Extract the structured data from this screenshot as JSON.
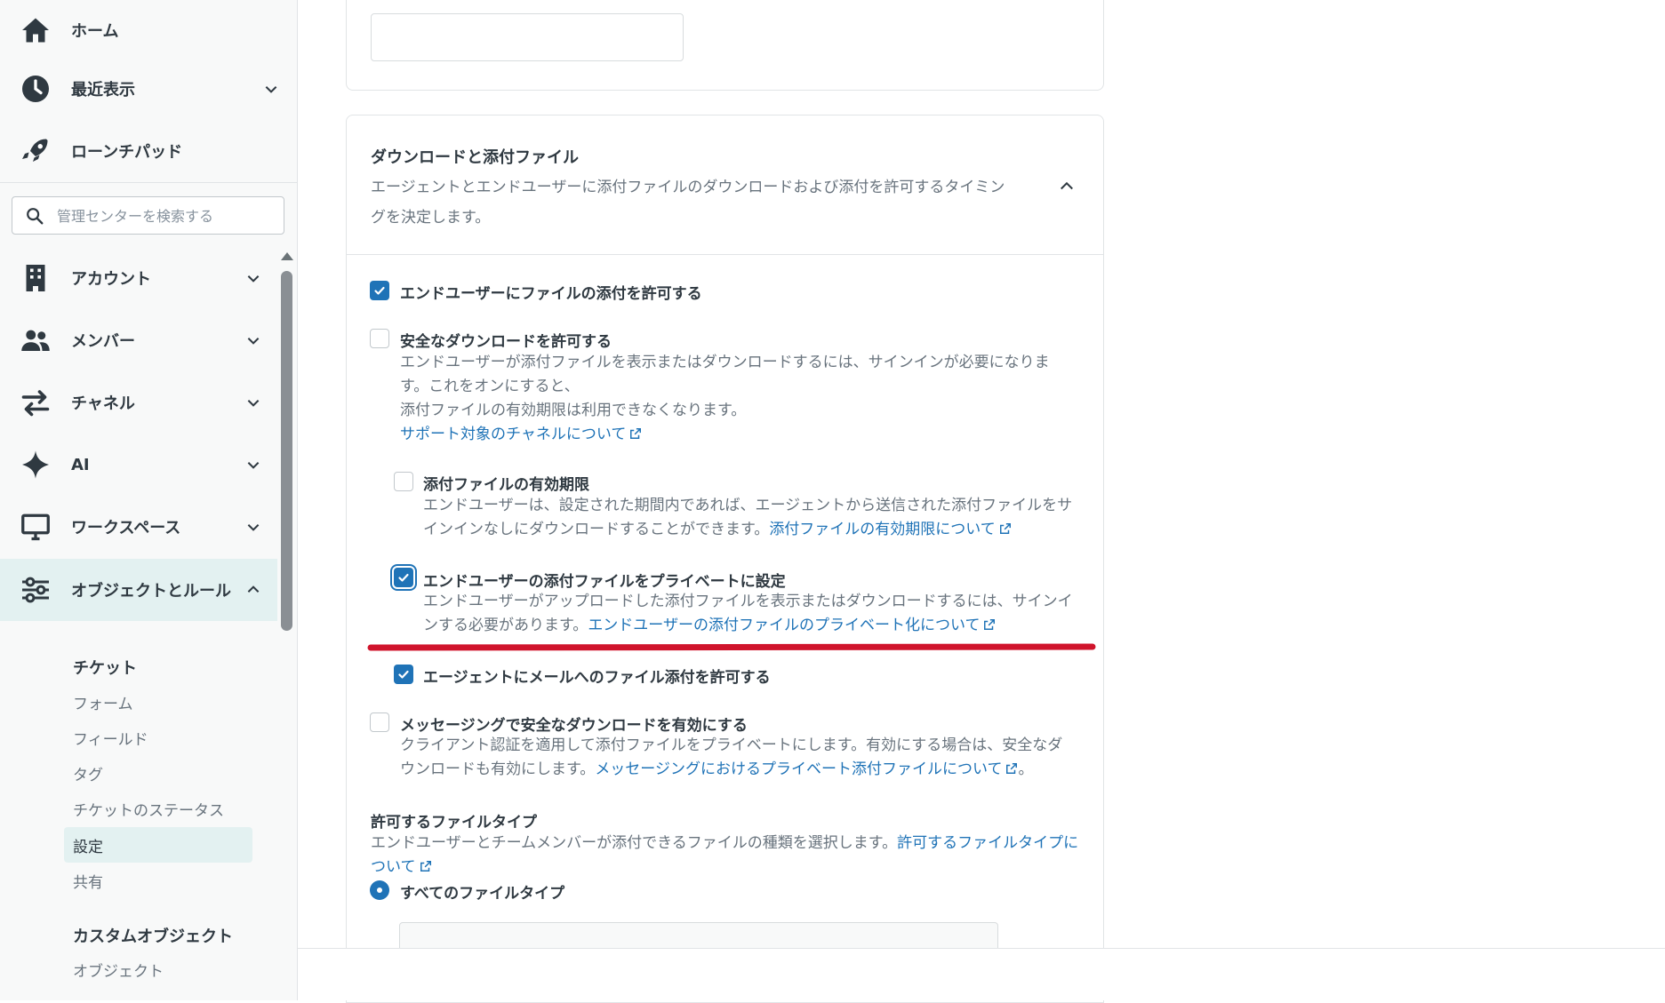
{
  "sidebar": {
    "nav": [
      {
        "label": "ホーム",
        "icon": "home-icon"
      },
      {
        "label": "最近表示",
        "icon": "clock-icon"
      },
      {
        "label": "ローンチパッド",
        "icon": "rocket-icon"
      },
      {
        "label": "アカウント",
        "icon": "building-icon"
      },
      {
        "label": "メンバー",
        "icon": "people-icon"
      },
      {
        "label": "チャネル",
        "icon": "arrows-swap-icon"
      },
      {
        "label": "AI",
        "icon": "sparkle-icon"
      },
      {
        "label": "ワークスペース",
        "icon": "monitor-icon"
      },
      {
        "label": "オブジェクトとルール",
        "icon": "sliders-icon"
      }
    ],
    "search_placeholder": "管理センターを検索する",
    "tickets_heading": "チケット",
    "tickets_items": [
      "フォーム",
      "フィールド",
      "タグ",
      "チケットのステータス",
      "設定",
      "共有"
    ],
    "custom_heading": "カスタムオブジェクト",
    "custom_items": [
      "オブジェクト"
    ]
  },
  "section": {
    "title": "ダウンロードと添付ファイル",
    "description": "エージェントとエンドユーザーに添付ファイルのダウンロードおよび添付を許可するタイミングを決定します。"
  },
  "options": {
    "allow_attach": {
      "label": "エンドユーザーにファイルの添付を許可する",
      "checked": true
    },
    "secure_download": {
      "label": "安全なダウンロードを許可する",
      "desc1": "エンドユーザーが添付ファイルを表示またはダウンロードするには、サインインが必要になります。これをオンにすると、",
      "desc2": "添付ファイルの有効期限は利用できなくなります。",
      "link": "サポート対象のチャネルについて",
      "checked": false
    },
    "expiry": {
      "label": "添付ファイルの有効期限",
      "desc": "エンドユーザーは、設定された期間内であれば、エージェントから送信された添付ファイルをサインインなしにダウンロードすることができます。",
      "link": "添付ファイルの有効期限について",
      "checked": false
    },
    "private": {
      "label": "エンドユーザーの添付ファイルをプライベートに設定",
      "desc": "エンドユーザーがアップロードした添付ファイルを表示またはダウンロードするには、サインインする必要があります。",
      "link": "エンドユーザーの添付ファイルのプライベート化について",
      "checked": true
    },
    "agent_mail": {
      "label": "エージェントにメールへのファイル添付を許可する",
      "checked": true
    },
    "messaging": {
      "label": "メッセージングで安全なダウンロードを有効にする",
      "desc": "クライアント認証を適用して添付ファイルをプライベートにします。有効にする場合は、安全なダウンロードも有効にします。",
      "link": "メッセージングにおけるプライベート添付ファイルについて",
      "suffix": "。",
      "checked": false
    }
  },
  "file_types": {
    "title": "許可するファイルタイプ",
    "desc": "エンドユーザーとチームメンバーが添付できるファイルの種類を選択します。",
    "link": "許可するファイルタイプについて",
    "radio_all": "すべてのファイルタイプ"
  },
  "colors": {
    "accent": "#1f73b7",
    "highlight": "#d0142c",
    "active_bg": "#e3f1f1"
  }
}
